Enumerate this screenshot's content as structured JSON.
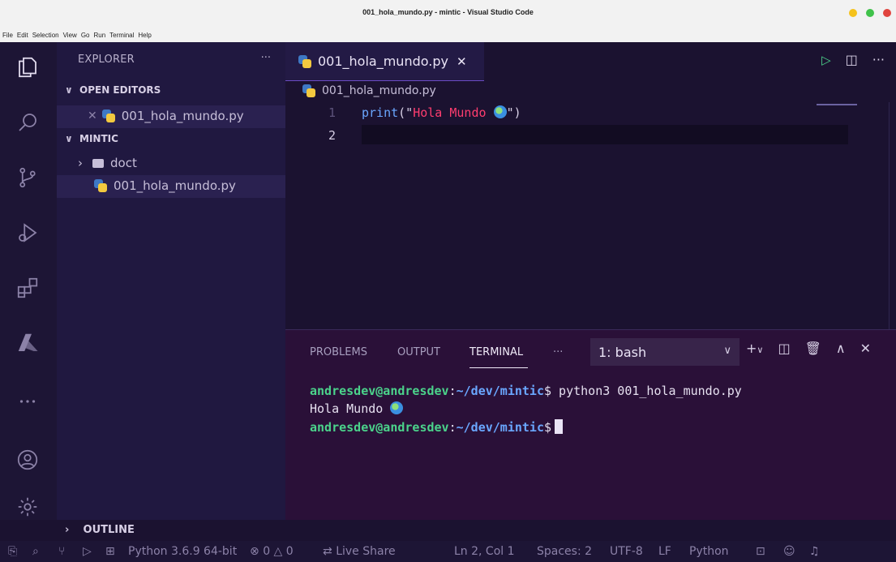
{
  "window": {
    "title": "001_hola_mundo.py - mintic - Visual Studio Code"
  },
  "menu": [
    "File",
    "Edit",
    "Selection",
    "View",
    "Go",
    "Run",
    "Terminal",
    "Help"
  ],
  "sidebar": {
    "header": "EXPLORER",
    "more": "···",
    "open_editors_label": "OPEN EDITORS",
    "open_editor_file": "001_hola_mundo.py",
    "folder_label": "MINTIC",
    "items": [
      {
        "name": "doct",
        "type": "folder"
      },
      {
        "name": "001_hola_mundo.py",
        "type": "python"
      }
    ],
    "outline_label": "OUTLINE"
  },
  "editor": {
    "tab_label": "001_hola_mundo.py",
    "breadcrumb": "001_hola_mundo.py",
    "lines": [
      {
        "number": "1",
        "fn": "print",
        "open": "(\"",
        "str": "Hola Mundo ",
        "close": "\")"
      },
      {
        "number": "2"
      }
    ]
  },
  "panel": {
    "tabs": [
      "PROBLEMS",
      "OUTPUT",
      "TERMINAL"
    ],
    "active_tab": "TERMINAL",
    "more": "···",
    "terminal_select": "1: bash",
    "terminal_lines": [
      {
        "user": "andresdev@andresdev",
        "colon": ":",
        "path": "~/dev/mintic",
        "prompt": "$",
        "cmd": " python3 001_hola_mundo.py"
      },
      {
        "output": "Hola Mundo "
      },
      {
        "user": "andresdev@andresdev",
        "colon": ":",
        "path": "~/dev/mintic",
        "prompt": "$",
        "cmd": ""
      }
    ]
  },
  "status": {
    "python": "Python 3.6.9 64-bit",
    "errors": "0",
    "warnings": "0",
    "live_share": "Live Share",
    "position": "Ln 2, Col 1",
    "spaces": "Spaces: 2",
    "encoding": "UTF-8",
    "eol": "LF",
    "language": "Python"
  },
  "colors": {
    "accent": "#6b4cc4",
    "string": "#ff3d6f",
    "function": "#6aa7ff",
    "terminal_user": "#4bd38b"
  }
}
